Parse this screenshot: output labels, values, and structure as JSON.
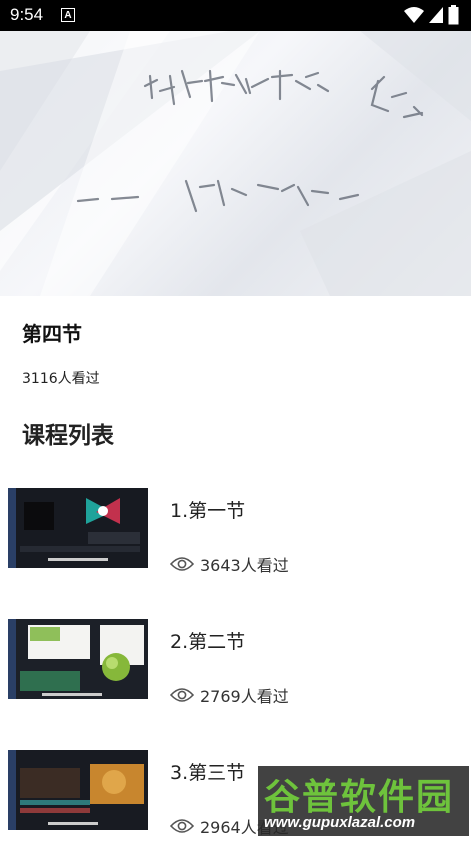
{
  "status_bar": {
    "time": "9:54",
    "notification_letter": "A"
  },
  "video": {
    "state": "paused"
  },
  "lesson": {
    "title": "第四节",
    "views": "3116人看过"
  },
  "course_list": {
    "heading": "课程列表",
    "items": [
      {
        "title": "1.第一节",
        "views": "3643人看过"
      },
      {
        "title": "2.第二节",
        "views": "2769人看过"
      },
      {
        "title": "3.第三节",
        "views": "2964人看过"
      }
    ]
  },
  "watermark": {
    "brand": "谷普软件园",
    "url": "www.gupuxlazal.com"
  },
  "colors": {
    "watermark_green": "#6ec33c",
    "status_bar": "#000000"
  }
}
